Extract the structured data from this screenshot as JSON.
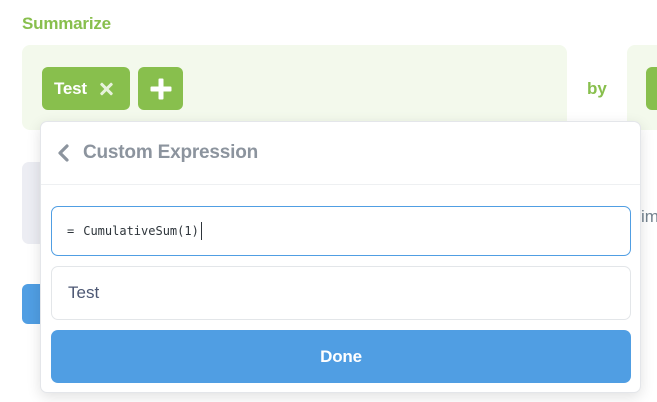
{
  "summarize": {
    "section_title": "Summarize",
    "metric_pill_label": "Test",
    "remove_icon": "close-icon",
    "add_icon": "plus-icon",
    "by_label": "by",
    "partial_right_text": "im"
  },
  "popover": {
    "back_icon": "chevron-left-icon",
    "title": "Custom Expression",
    "expression": {
      "prefix": "=",
      "value": "CumulativeSum(1)"
    },
    "name_value": "Test",
    "done_label": "Done"
  },
  "colors": {
    "brand_green": "#88bf4d",
    "brand_green_light": "#f3f9ec",
    "accent_blue": "#509ee3",
    "title_grey": "#8c949e"
  }
}
